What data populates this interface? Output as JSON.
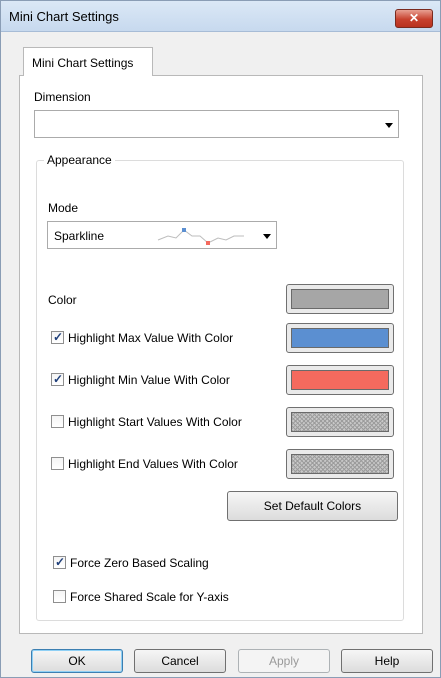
{
  "window": {
    "title": "Mini Chart Settings",
    "close_glyph": "✕"
  },
  "tab": {
    "label": "Mini Chart Settings"
  },
  "dimension": {
    "label": "Dimension",
    "value": ""
  },
  "appearance": {
    "legend": "Appearance",
    "mode": {
      "label": "Mode",
      "value": "Sparkline"
    },
    "color": {
      "label": "Color",
      "swatch": "#a6a6a6"
    },
    "highlights": [
      {
        "label": "Highlight Max Value With Color",
        "checked": true,
        "swatch": "#5b8fd1"
      },
      {
        "label": "Highlight Min Value With Color",
        "checked": true,
        "swatch": "#f46a5e"
      },
      {
        "label": "Highlight Start Values With Color",
        "checked": false,
        "swatch": "pattern"
      },
      {
        "label": "Highlight End Values With Color",
        "checked": false,
        "swatch": "pattern"
      }
    ],
    "set_default_label": "Set Default Colors"
  },
  "options": [
    {
      "label": "Force Zero Based Scaling",
      "checked": true
    },
    {
      "label": "Force Shared Scale for Y-axis",
      "checked": false
    }
  ],
  "buttons": {
    "ok": "OK",
    "cancel": "Cancel",
    "apply": "Apply",
    "help": "Help"
  },
  "check_glyph": "✓",
  "colors": {
    "title_bg": "#c7d9ee",
    "close_red": "#c7412e",
    "ok_border": "#3c7fb1"
  }
}
